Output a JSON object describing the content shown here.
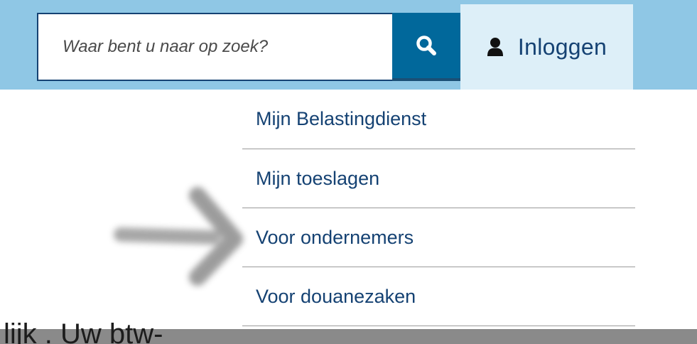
{
  "search": {
    "placeholder": "Waar bent u naar op zoek?"
  },
  "header": {
    "login_label": "Inloggen",
    "search_icon": "search-icon",
    "user_icon": "user-icon"
  },
  "menu": {
    "items": [
      {
        "label": "Mijn Belastingdienst"
      },
      {
        "label": "Mijn toeslagen"
      },
      {
        "label": "Voor ondernemers"
      },
      {
        "label": "Voor douanezaken"
      }
    ]
  },
  "body": {
    "snippet": "lijk . Uw btw-"
  },
  "colors": {
    "header_band": "#8fc7e5",
    "search_button": "#01689b",
    "login_button": "#ddeff8",
    "text_primary": "#154273",
    "divider": "#9a9a9a",
    "bottom_band": "#8a8a8a"
  }
}
